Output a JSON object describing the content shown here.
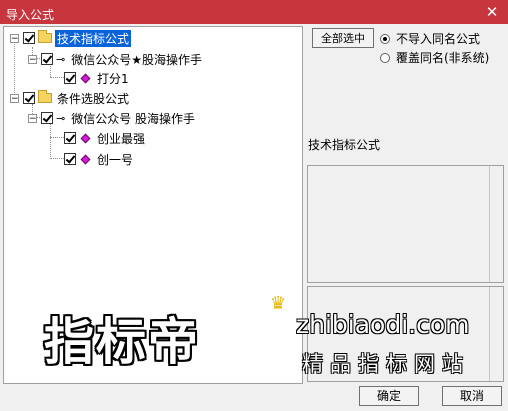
{
  "window": {
    "title": "导入公式",
    "close_glyph": "✕"
  },
  "tree": {
    "groups": [
      {
        "label": "技术指标公式",
        "selected": true,
        "children": [
          {
            "label": "微信公众号★股海操作手",
            "children": [
              {
                "label": "打分1"
              }
            ]
          }
        ]
      },
      {
        "label": "条件选股公式",
        "selected": false,
        "children": [
          {
            "label": "微信公众号 股海操作手",
            "children": [
              {
                "label": "创业最强"
              },
              {
                "label": "创一号"
              }
            ]
          }
        ]
      }
    ]
  },
  "options": {
    "select_all_label": "全部选中",
    "radio_skip_label": "不导入同名公式",
    "radio_overwrite_label": "覆盖同名(非系统)",
    "selected_radio": "skip"
  },
  "description": {
    "label": "技术指标公式"
  },
  "footer": {
    "ok_label": "确定",
    "cancel_label": "取消"
  },
  "watermark": {
    "logo_text": "指标帝",
    "url_text": "zhibiaodi.com",
    "slogan_text": "精品指标网站"
  },
  "colors": {
    "titlebar": "#c7353d",
    "selection": "#0a64d8",
    "item_icon": "#d020d0"
  }
}
